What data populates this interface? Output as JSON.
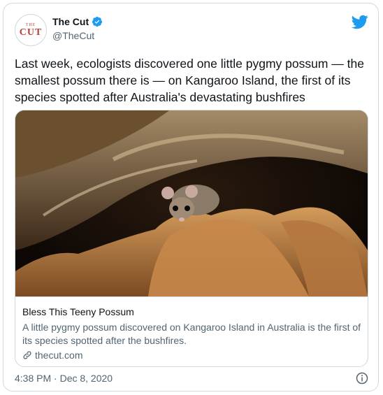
{
  "account": {
    "avatar_top": "THE",
    "avatar_bottom": "CUT",
    "name": "The Cut",
    "handle": "@TheCut"
  },
  "tweet": {
    "text": "Last week, ecologists discovered one little pygmy possum — the smallest possum there is — on Kangaroo Island, the first of its species spotted after Australia's devastating bushfires",
    "timestamp": "4:38 PM · Dec 8, 2020"
  },
  "card": {
    "title": "Bless This Teeny Possum",
    "description": "A little pygmy possum discovered on Kangaroo Island in Australia is the first of its species spotted after the bushfires.",
    "domain": "thecut.com"
  },
  "icons": {
    "verified": "verified-badge-icon",
    "bird": "twitter-bird-icon",
    "link": "link-icon",
    "info": "info-icon"
  },
  "colors": {
    "brand_blue": "#1d9bf0",
    "avatar_red": "#b4403c",
    "secondary_text": "#536471",
    "border": "#cfd9de"
  }
}
